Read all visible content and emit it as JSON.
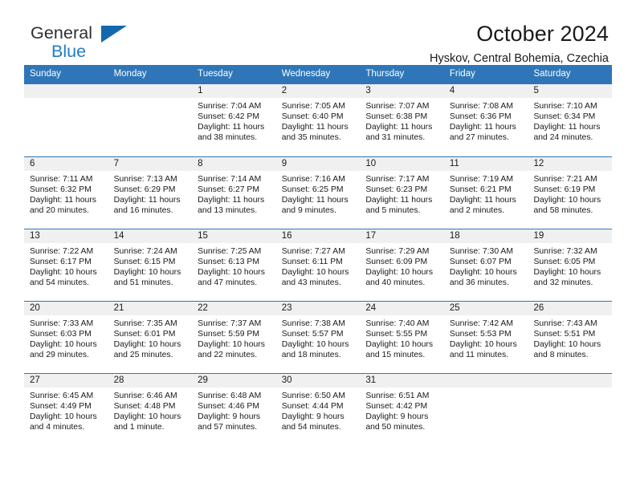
{
  "brand": {
    "name_top": "General",
    "name_bottom": "Blue",
    "triangle_color": "#1668ad",
    "blue_color": "#1f7ec4"
  },
  "header": {
    "title": "October 2024",
    "subtitle": "Hyskov, Central Bohemia, Czechia"
  },
  "theme": {
    "header_blue": "#2e76b8",
    "daynum_band": "#f0f0f0",
    "text": "#1a1a1a"
  },
  "calendar": {
    "day_headers": [
      "Sunday",
      "Monday",
      "Tuesday",
      "Wednesday",
      "Thursday",
      "Friday",
      "Saturday"
    ],
    "labels": {
      "sunrise": "Sunrise:",
      "sunset": "Sunset:",
      "daylight": "Daylight:"
    },
    "weeks": [
      [
        {
          "day": "",
          "empty": true
        },
        {
          "day": "",
          "empty": true
        },
        {
          "day": "1",
          "sunrise": "Sunrise: 7:04 AM",
          "sunset": "Sunset: 6:42 PM",
          "daylight": "Daylight: 11 hours and 38 minutes."
        },
        {
          "day": "2",
          "sunrise": "Sunrise: 7:05 AM",
          "sunset": "Sunset: 6:40 PM",
          "daylight": "Daylight: 11 hours and 35 minutes."
        },
        {
          "day": "3",
          "sunrise": "Sunrise: 7:07 AM",
          "sunset": "Sunset: 6:38 PM",
          "daylight": "Daylight: 11 hours and 31 minutes."
        },
        {
          "day": "4",
          "sunrise": "Sunrise: 7:08 AM",
          "sunset": "Sunset: 6:36 PM",
          "daylight": "Daylight: 11 hours and 27 minutes."
        },
        {
          "day": "5",
          "sunrise": "Sunrise: 7:10 AM",
          "sunset": "Sunset: 6:34 PM",
          "daylight": "Daylight: 11 hours and 24 minutes."
        }
      ],
      [
        {
          "day": "6",
          "sunrise": "Sunrise: 7:11 AM",
          "sunset": "Sunset: 6:32 PM",
          "daylight": "Daylight: 11 hours and 20 minutes."
        },
        {
          "day": "7",
          "sunrise": "Sunrise: 7:13 AM",
          "sunset": "Sunset: 6:29 PM",
          "daylight": "Daylight: 11 hours and 16 minutes."
        },
        {
          "day": "8",
          "sunrise": "Sunrise: 7:14 AM",
          "sunset": "Sunset: 6:27 PM",
          "daylight": "Daylight: 11 hours and 13 minutes."
        },
        {
          "day": "9",
          "sunrise": "Sunrise: 7:16 AM",
          "sunset": "Sunset: 6:25 PM",
          "daylight": "Daylight: 11 hours and 9 minutes."
        },
        {
          "day": "10",
          "sunrise": "Sunrise: 7:17 AM",
          "sunset": "Sunset: 6:23 PM",
          "daylight": "Daylight: 11 hours and 5 minutes."
        },
        {
          "day": "11",
          "sunrise": "Sunrise: 7:19 AM",
          "sunset": "Sunset: 6:21 PM",
          "daylight": "Daylight: 11 hours and 2 minutes."
        },
        {
          "day": "12",
          "sunrise": "Sunrise: 7:21 AM",
          "sunset": "Sunset: 6:19 PM",
          "daylight": "Daylight: 10 hours and 58 minutes."
        }
      ],
      [
        {
          "day": "13",
          "sunrise": "Sunrise: 7:22 AM",
          "sunset": "Sunset: 6:17 PM",
          "daylight": "Daylight: 10 hours and 54 minutes."
        },
        {
          "day": "14",
          "sunrise": "Sunrise: 7:24 AM",
          "sunset": "Sunset: 6:15 PM",
          "daylight": "Daylight: 10 hours and 51 minutes."
        },
        {
          "day": "15",
          "sunrise": "Sunrise: 7:25 AM",
          "sunset": "Sunset: 6:13 PM",
          "daylight": "Daylight: 10 hours and 47 minutes."
        },
        {
          "day": "16",
          "sunrise": "Sunrise: 7:27 AM",
          "sunset": "Sunset: 6:11 PM",
          "daylight": "Daylight: 10 hours and 43 minutes."
        },
        {
          "day": "17",
          "sunrise": "Sunrise: 7:29 AM",
          "sunset": "Sunset: 6:09 PM",
          "daylight": "Daylight: 10 hours and 40 minutes."
        },
        {
          "day": "18",
          "sunrise": "Sunrise: 7:30 AM",
          "sunset": "Sunset: 6:07 PM",
          "daylight": "Daylight: 10 hours and 36 minutes."
        },
        {
          "day": "19",
          "sunrise": "Sunrise: 7:32 AM",
          "sunset": "Sunset: 6:05 PM",
          "daylight": "Daylight: 10 hours and 32 minutes."
        }
      ],
      [
        {
          "day": "20",
          "sunrise": "Sunrise: 7:33 AM",
          "sunset": "Sunset: 6:03 PM",
          "daylight": "Daylight: 10 hours and 29 minutes."
        },
        {
          "day": "21",
          "sunrise": "Sunrise: 7:35 AM",
          "sunset": "Sunset: 6:01 PM",
          "daylight": "Daylight: 10 hours and 25 minutes."
        },
        {
          "day": "22",
          "sunrise": "Sunrise: 7:37 AM",
          "sunset": "Sunset: 5:59 PM",
          "daylight": "Daylight: 10 hours and 22 minutes."
        },
        {
          "day": "23",
          "sunrise": "Sunrise: 7:38 AM",
          "sunset": "Sunset: 5:57 PM",
          "daylight": "Daylight: 10 hours and 18 minutes."
        },
        {
          "day": "24",
          "sunrise": "Sunrise: 7:40 AM",
          "sunset": "Sunset: 5:55 PM",
          "daylight": "Daylight: 10 hours and 15 minutes."
        },
        {
          "day": "25",
          "sunrise": "Sunrise: 7:42 AM",
          "sunset": "Sunset: 5:53 PM",
          "daylight": "Daylight: 10 hours and 11 minutes."
        },
        {
          "day": "26",
          "sunrise": "Sunrise: 7:43 AM",
          "sunset": "Sunset: 5:51 PM",
          "daylight": "Daylight: 10 hours and 8 minutes."
        }
      ],
      [
        {
          "day": "27",
          "sunrise": "Sunrise: 6:45 AM",
          "sunset": "Sunset: 4:49 PM",
          "daylight": "Daylight: 10 hours and 4 minutes."
        },
        {
          "day": "28",
          "sunrise": "Sunrise: 6:46 AM",
          "sunset": "Sunset: 4:48 PM",
          "daylight": "Daylight: 10 hours and 1 minute."
        },
        {
          "day": "29",
          "sunrise": "Sunrise: 6:48 AM",
          "sunset": "Sunset: 4:46 PM",
          "daylight": "Daylight: 9 hours and 57 minutes."
        },
        {
          "day": "30",
          "sunrise": "Sunrise: 6:50 AM",
          "sunset": "Sunset: 4:44 PM",
          "daylight": "Daylight: 9 hours and 54 minutes."
        },
        {
          "day": "31",
          "sunrise": "Sunrise: 6:51 AM",
          "sunset": "Sunset: 4:42 PM",
          "daylight": "Daylight: 9 hours and 50 minutes."
        },
        {
          "day": "",
          "empty": true
        },
        {
          "day": "",
          "empty": true
        }
      ]
    ]
  }
}
